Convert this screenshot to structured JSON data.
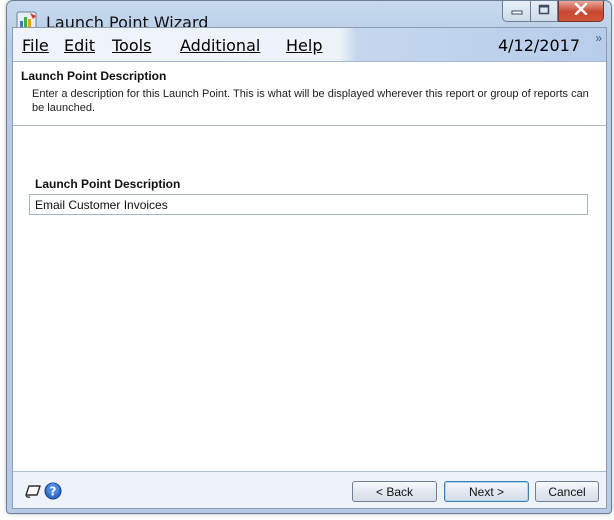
{
  "window": {
    "title": "Launch Point Wizard"
  },
  "menu": {
    "items": [
      {
        "label": "File"
      },
      {
        "label": "Edit"
      },
      {
        "label": "Tools"
      },
      {
        "label": "Additional"
      },
      {
        "label": "Help"
      }
    ],
    "date": "4/12/2017"
  },
  "description_panel": {
    "title": "Launch Point Description",
    "body": "Enter a description for this Launch Point.  This is what will be displayed wherever this report or group of reports can be launched."
  },
  "form": {
    "label": "Launch Point Description",
    "value": "Email Customer Invoices"
  },
  "footer": {
    "back_label": "< Back",
    "next_label": "Next >",
    "cancel_label": "Cancel"
  },
  "icons": {
    "app": "wizard-app-icon",
    "minimize": "minimize-icon",
    "maximize": "maximize-icon",
    "close": "close-icon",
    "overflow": "chevron-double-right-icon",
    "note": "note-icon",
    "help": "help-icon"
  }
}
